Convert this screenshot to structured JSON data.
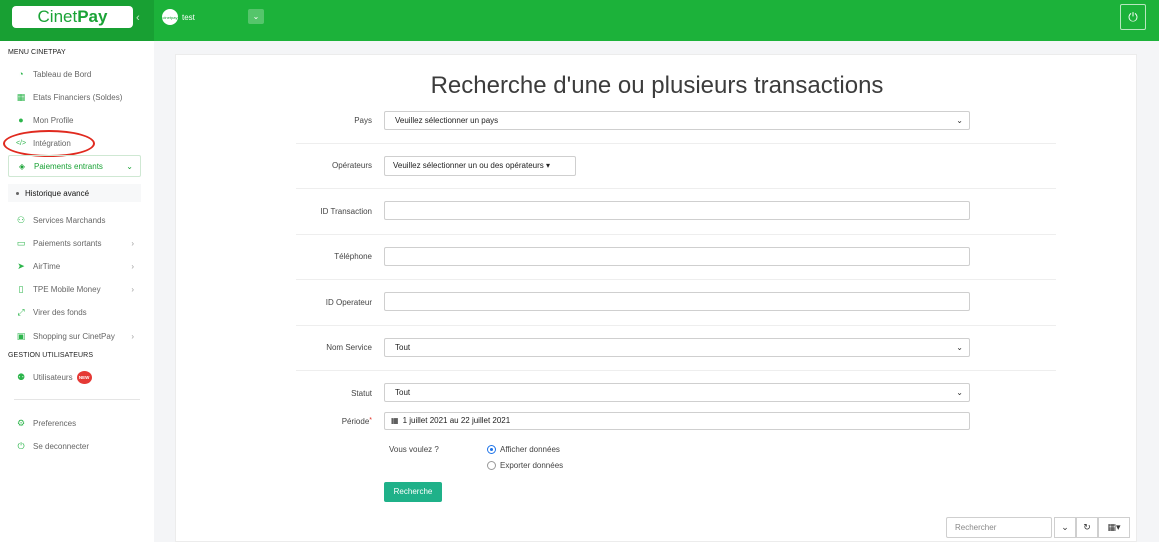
{
  "header": {
    "logo_text_a": "Cinet",
    "logo_text_b": "Pay",
    "collapse_glyph": "‹",
    "account_avatar_text": "cinetpay",
    "account_name": "test",
    "account_dropdown_glyph": "⌄",
    "power_glyph": "⏻"
  },
  "sidebar": {
    "menu_title": "MENU CINETPAY",
    "items": [
      {
        "label": "Tableau de Bord",
        "icon": "dashboard-icon",
        "glyph": "◔"
      },
      {
        "label": "Etats Financiers (Soldes)",
        "icon": "calculator-icon",
        "glyph": "▦"
      },
      {
        "label": "Mon Profile",
        "icon": "user-icon",
        "glyph": "●"
      },
      {
        "label": "Intégration",
        "icon": "code-icon",
        "glyph": "</>"
      }
    ],
    "active_group": {
      "label": "Paiements entrants",
      "icon": "money-icon",
      "glyph": "◈",
      "chevron": "⌄"
    },
    "sub_item": "Historique avancé",
    "items2": [
      {
        "label": "Services Marchands",
        "icon": "sitemap-icon",
        "glyph": "⚇",
        "chevron": ""
      },
      {
        "label": "Paiements sortants",
        "icon": "credit-card-icon",
        "glyph": "▭",
        "chevron": "›"
      },
      {
        "label": "AirTime",
        "icon": "send-icon",
        "glyph": "➤",
        "chevron": "›"
      },
      {
        "label": "TPE Mobile Money",
        "icon": "mobile-icon",
        "glyph": "▯",
        "chevron": "›"
      },
      {
        "label": "Virer des fonds",
        "icon": "transfer-icon",
        "glyph": "⤢",
        "chevron": ""
      },
      {
        "label": "Shopping sur CinetPay",
        "icon": "shopping-icon",
        "glyph": "▣",
        "chevron": "›"
      }
    ],
    "users_title": "GESTION UTILISATEURS",
    "users_item": {
      "label": "Utilisateurs",
      "icon": "users-icon",
      "glyph": "⚉",
      "badge": "NEW"
    },
    "bottom_items": [
      {
        "label": "Preferences",
        "icon": "gear-icon",
        "glyph": "⚙"
      },
      {
        "label": "Se deconnecter",
        "icon": "power-icon",
        "glyph": "⏻"
      }
    ]
  },
  "main": {
    "title": "Recherche d'une ou plusieurs transactions",
    "pays_label": "Pays",
    "pays_value": "Veuillez sélectionner un pays",
    "operateurs_label": "Opérateurs",
    "operateurs_value": "Veuillez sélectionner un ou des opérateurs ▾",
    "id_transaction_label": "ID Transaction",
    "id_transaction_value": "",
    "telephone_label": "Téléphone",
    "telephone_value": "",
    "id_operateur_label": "ID Operateur",
    "id_operateur_value": "",
    "nom_service_label": "Nom Service",
    "nom_service_value": "Tout",
    "statut_label": "Statut",
    "statut_value": "Tout",
    "periode_label": "Période",
    "periode_required": "*",
    "periode_value": "1 juillet 2021 au 22 juillet 2021",
    "calendar_glyph": "▦",
    "question": "Vous voulez ?",
    "radio_afficher": "Afficher données",
    "radio_exporter": "Exporter données",
    "search_button": "Recherche",
    "bottom_search_placeholder": "Rechercher",
    "tool_chevron": "⌄",
    "tool_refresh": "↻",
    "tool_columns": "▦▾",
    "select_caret": "⌄"
  },
  "colors": {
    "topbar": "#1cb23a",
    "accent_green": "#1aa336",
    "search_button": "#1fb189",
    "annotation_red": "#e02a1f"
  }
}
